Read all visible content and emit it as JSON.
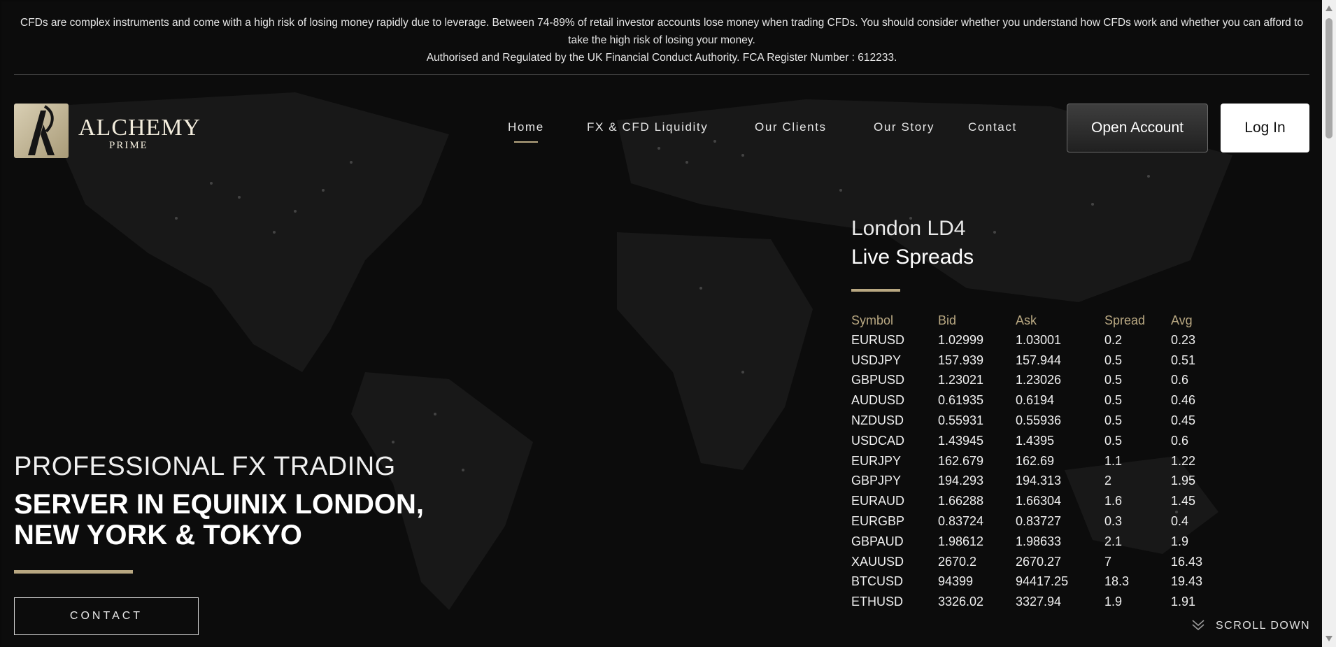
{
  "risk_warning": {
    "line1": "CFDs are complex instruments and come with a high risk of losing money rapidly due to leverage. Between 74-89% of retail investor accounts lose money when trading CFDs. You should consider whether you understand how CFDs work and whether you can afford to take the high risk of losing your money.",
    "line2": "Authorised and Regulated by the UK Financial Conduct Authority. FCA Register Number : 612233."
  },
  "brand": {
    "name": "ALCHEMY",
    "sub": "PRIME"
  },
  "nav": {
    "items": [
      {
        "label": "Home",
        "active": true
      },
      {
        "label": "FX & CFD Liquidity"
      },
      {
        "label": "Our Clients"
      },
      {
        "label": "Our Story"
      },
      {
        "label": "Contact"
      }
    ],
    "open_account": "Open Account",
    "log_in": "Log In"
  },
  "spreads": {
    "location": "London LD4",
    "title": "Live Spreads",
    "headers": [
      "Symbol",
      "Bid",
      "Ask",
      "Spread",
      "Avg"
    ],
    "rows": [
      [
        "EURUSD",
        "1.02999",
        "1.03001",
        "0.2",
        "0.23"
      ],
      [
        "USDJPY",
        "157.939",
        "157.944",
        "0.5",
        "0.51"
      ],
      [
        "GBPUSD",
        "1.23021",
        "1.23026",
        "0.5",
        "0.6"
      ],
      [
        "AUDUSD",
        "0.61935",
        "0.6194",
        "0.5",
        "0.46"
      ],
      [
        "NZDUSD",
        "0.55931",
        "0.55936",
        "0.5",
        "0.45"
      ],
      [
        "USDCAD",
        "1.43945",
        "1.4395",
        "0.5",
        "0.6"
      ],
      [
        "EURJPY",
        "162.679",
        "162.69",
        "1.1",
        "1.22"
      ],
      [
        "GBPJPY",
        "194.293",
        "194.313",
        "2",
        "1.95"
      ],
      [
        "EURAUD",
        "1.66288",
        "1.66304",
        "1.6",
        "1.45"
      ],
      [
        "EURGBP",
        "0.83724",
        "0.83727",
        "0.3",
        "0.4"
      ],
      [
        "GBPAUD",
        "1.98612",
        "1.98633",
        "2.1",
        "1.9"
      ],
      [
        "XAUUSD",
        "2670.2",
        "2670.27",
        "7",
        "16.43"
      ],
      [
        "BTCUSD",
        "94399",
        "94417.25",
        "18.3",
        "19.43"
      ],
      [
        "ETHUSD",
        "3326.02",
        "3327.94",
        "1.9",
        "1.91"
      ]
    ]
  },
  "hero": {
    "subtitle": "PROFESSIONAL FX TRADING",
    "title_line1": "SERVER IN EQUINIX LONDON,",
    "title_line2": "NEW YORK & TOKYO",
    "contact": "CONTACT"
  },
  "scroll": {
    "label": "SCROLL DOWN",
    "icon": "chevron-double-down-icon"
  },
  "colors": {
    "accent": "#b9a882",
    "background": "#0c0c0c"
  }
}
